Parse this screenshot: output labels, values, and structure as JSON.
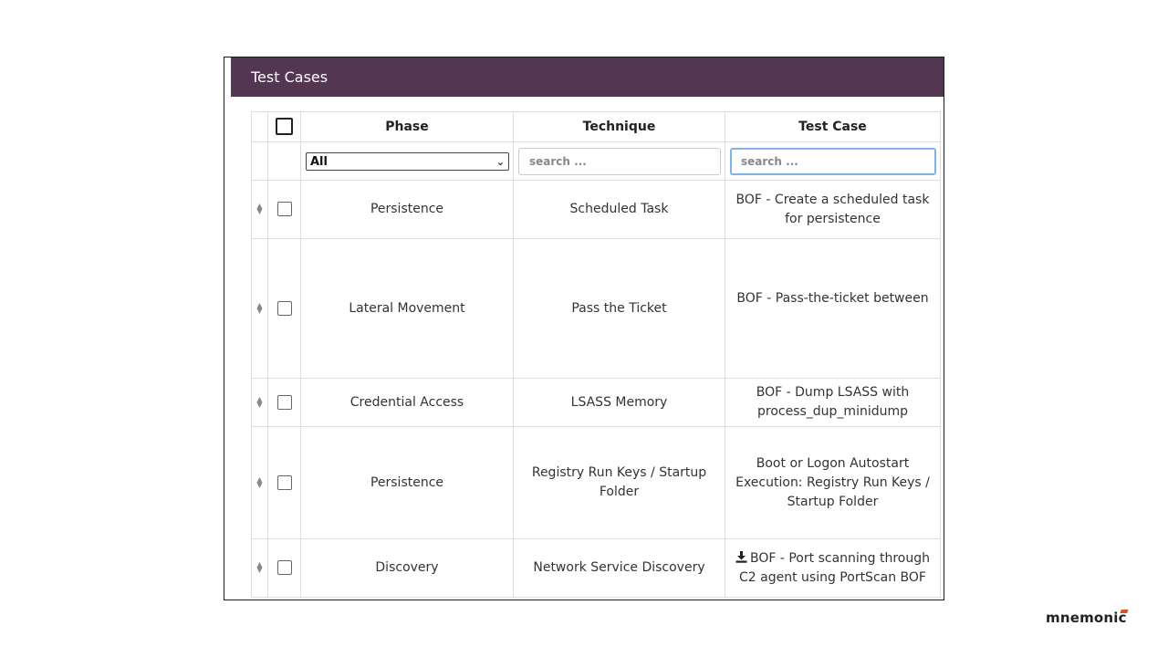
{
  "panel": {
    "title": "Test Cases"
  },
  "table": {
    "headers": {
      "phase": "Phase",
      "technique": "Technique",
      "test_case": "Test Case"
    },
    "filters": {
      "phase_selected": "All",
      "technique_placeholder": "search ...",
      "test_case_placeholder": "search ..."
    },
    "rows": [
      {
        "phase": "Persistence",
        "technique": "Scheduled Task",
        "test_case": "BOF - Create a scheduled task for persistence"
      },
      {
        "phase": "Lateral Movement",
        "technique": "Pass the Ticket",
        "test_case": "BOF - Pass-the-ticket between"
      },
      {
        "phase": "Credential Access",
        "technique": "LSASS Memory",
        "test_case": "BOF - Dump LSASS with process_dup_minidump"
      },
      {
        "phase": "Persistence",
        "technique": "Registry Run Keys / Startup Folder",
        "test_case": "Boot or Logon Autostart Execution: Registry Run Keys / Startup Folder"
      },
      {
        "phase": "Discovery",
        "technique": "Network Service Discovery",
        "test_case": "BOF - Port scanning through C2 agent using PortScan BOF"
      }
    ]
  },
  "icons": {
    "drag_handle": "sort-arrows-icon",
    "checkbox": "checkbox-icon",
    "download": "download-icon",
    "chevron": "chevron-down-icon"
  },
  "colors": {
    "header_bg": "#533652",
    "focus_border": "#80b4e8",
    "brand_accent": "#d8542a"
  },
  "branding": {
    "logo_text": "mnemonic"
  }
}
